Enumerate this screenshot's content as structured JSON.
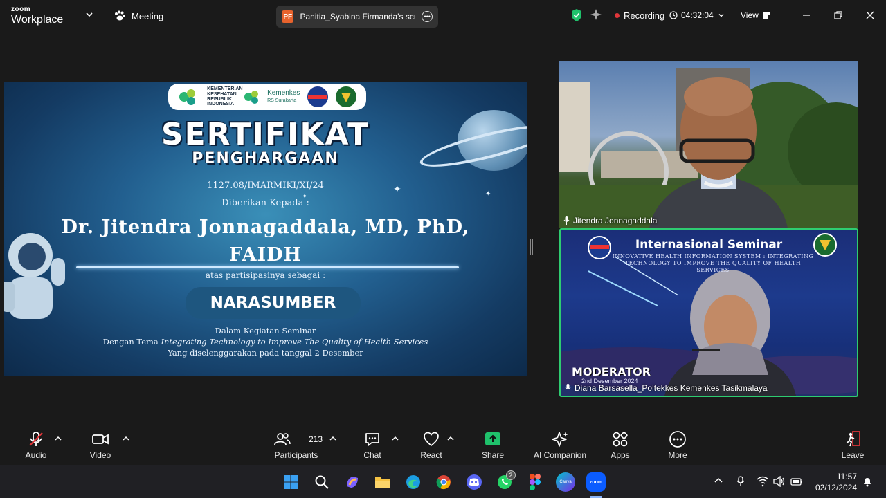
{
  "app": {
    "brand_top": "zoom",
    "brand_bottom": "Workplace",
    "meeting_label": "Meeting"
  },
  "share": {
    "initials": "PF",
    "text": "Panitia_Syabina Firmanda's screen"
  },
  "status": {
    "recording": "Recording",
    "timer": "04:32:04",
    "view": "View"
  },
  "slide": {
    "logos": [
      "KEMENTERIAN KESEHATAN REPUBLIK INDONESIA",
      "Kemenkes",
      "RS Surakarta",
      "OPTIMIKI"
    ],
    "title": "SERTIFIKAT",
    "subtitle": "PENGHARGAAN",
    "number": "1127.08/IMARMIKI/XI/24",
    "given_to": "Diberikan Kepada :",
    "recipient_line1": "Dr. Jitendra Jonnagaddala, MD, PhD,",
    "recipient_line2": "FAIDH",
    "participation": "atas partisipasinya sebagai :",
    "role": "NARASUMBER",
    "activity": "Dalam Kegiatan Seminar",
    "theme_prefix": "Dengan Tema",
    "theme": "Integrating Technology to Improve The Quality of Health Services",
    "held_on": "Yang diselenggarakan pada tanggal 2 Desember"
  },
  "participants": [
    {
      "name": "Jitendra Jonnagaddala"
    },
    {
      "name": "Diana Barsasella_Poltekkes Kemenkes Tasikmalaya"
    }
  ],
  "moderator_bg": {
    "title": "Internasional Seminar",
    "subtitle": "INNOVATIVE HEALTH INFORMATION SYSTEM : INTEGRATING TECHNOLOGY TO IMPROVE THE QUALITY OF HEALTH SERVICES",
    "label": "MODERATOR",
    "date": "2nd Desember 2024"
  },
  "toolbar": {
    "audio": "Audio",
    "video": "Video",
    "participants": "Participants",
    "participant_count": "213",
    "chat": "Chat",
    "react": "React",
    "share": "Share",
    "ai": "AI Companion",
    "apps": "Apps",
    "more": "More",
    "leave": "Leave"
  },
  "taskbar": {
    "time": "11:57",
    "date": "02/12/2024",
    "whatsapp_badge": "2",
    "zoom_label": "zoom",
    "canva_label": "Canva"
  },
  "colors": {
    "active_border": "#2ecc71",
    "record_dot": "#e0363a",
    "share_green": "#1fc16b",
    "leave_red": "#e0363a"
  }
}
